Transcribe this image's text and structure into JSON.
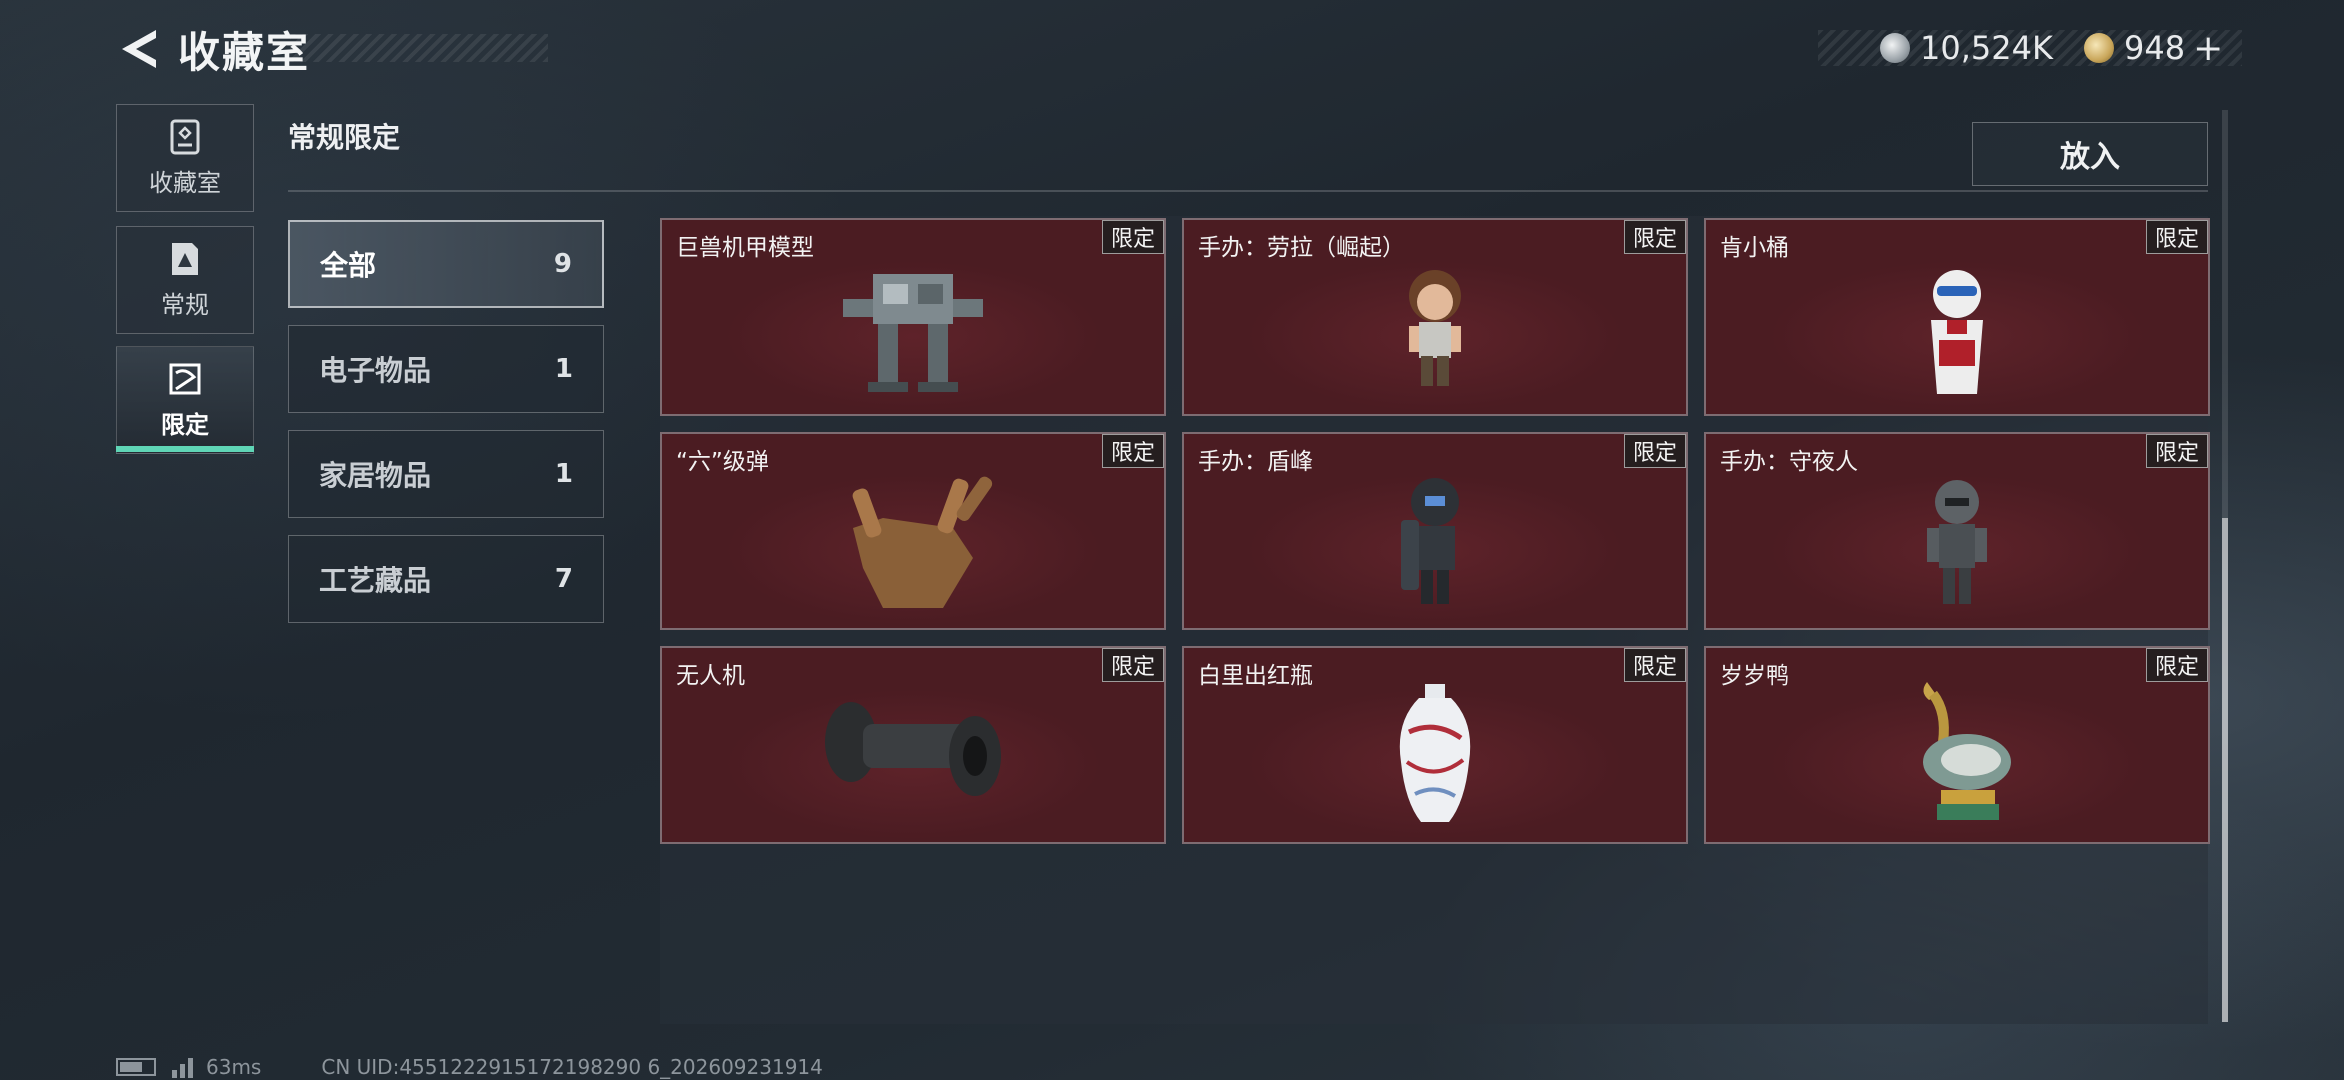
{
  "header": {
    "title": "收藏室",
    "currency": [
      {
        "icon": "silver-coin-icon",
        "value": "10,524K"
      },
      {
        "icon": "gold-coin-icon",
        "value": "948",
        "suffix": "+"
      }
    ]
  },
  "nav": [
    {
      "label": "收藏室",
      "icon": "collection-room-icon"
    },
    {
      "label": "常规",
      "icon": "regular-item-icon"
    },
    {
      "label": "限定",
      "icon": "limited-item-icon",
      "active": true
    }
  ],
  "section": {
    "title": "常规限定",
    "place_button": "放入"
  },
  "categories": [
    {
      "name": "全部",
      "count": "9",
      "active": true
    },
    {
      "name": "电子物品",
      "count": "1"
    },
    {
      "name": "家居物品",
      "count": "1"
    },
    {
      "name": "工艺藏品",
      "count": "7"
    }
  ],
  "items": [
    {
      "name": "巨兽机甲模型",
      "tag": "限定",
      "art": "mech-icon"
    },
    {
      "name": "手办：劳拉（崛起）",
      "tag": "限定",
      "art": "figure-icon"
    },
    {
      "name": "肯小桶",
      "tag": "限定",
      "art": "bucket-figure-icon"
    },
    {
      "name": "“六”级弹",
      "tag": "限定",
      "art": "bullet-hand-icon"
    },
    {
      "name": "手办：盾峰",
      "tag": "限定",
      "art": "shield-figure-icon"
    },
    {
      "name": "手办：守夜人",
      "tag": "限定",
      "art": "robot-figure-icon"
    },
    {
      "name": "无人机",
      "tag": "限定",
      "art": "drone-icon"
    },
    {
      "name": "白里出红瓶",
      "tag": "限定",
      "art": "vase-icon"
    },
    {
      "name": "岁岁鸭",
      "tag": "限定",
      "art": "duck-icon"
    }
  ],
  "footer": {
    "ping": "63ms",
    "uid": "CN UID:4551222915172198290 6_202609231914"
  },
  "colors": {
    "accent": "#5fd5b6",
    "card_bg": "#4b1c22"
  }
}
